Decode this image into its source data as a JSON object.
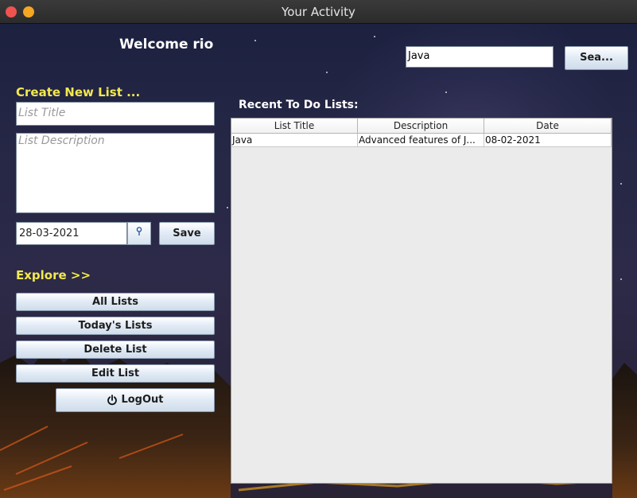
{
  "window": {
    "title": "Your Activity"
  },
  "header": {
    "welcome": "Welcome rio"
  },
  "search": {
    "value": "Java",
    "button_label": "Sea..."
  },
  "create": {
    "section_label": "Create New List ...",
    "title_placeholder": "List Title",
    "description_placeholder": "List Description",
    "date_value": "28-03-2021",
    "save_label": "Save",
    "calendar_icon": "calendar-pin-icon"
  },
  "explore": {
    "section_label": "Explore >>",
    "buttons": [
      "All Lists",
      "Today's Lists",
      "Delete List",
      "Edit List"
    ],
    "logout_label": "LogOut",
    "logout_icon": "power-icon"
  },
  "recent": {
    "section_label": "Recent To Do Lists:",
    "columns": [
      "List Title",
      "Description",
      "Date"
    ],
    "rows": [
      {
        "title": "Java",
        "description": "Advanced features of J...",
        "date": "08-02-2021"
      }
    ]
  },
  "colors": {
    "accent_label": "#f2e94e",
    "background_sky": "#262846"
  }
}
